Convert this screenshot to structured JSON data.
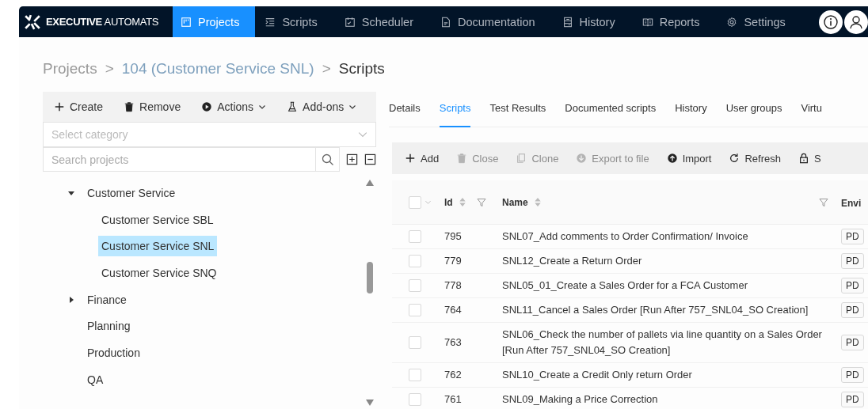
{
  "nav": {
    "logo_bold": "EXECUTIVE",
    "logo_light": "AUTOMATS",
    "items": [
      {
        "label": "Projects",
        "selected": true
      },
      {
        "label": "Scripts",
        "selected": false
      },
      {
        "label": "Scheduler",
        "selected": false
      },
      {
        "label": "Documentation",
        "selected": false
      },
      {
        "label": "History",
        "selected": false
      },
      {
        "label": "Reports",
        "selected": false
      },
      {
        "label": "Settings",
        "selected": false
      }
    ]
  },
  "breadcrumb": [
    {
      "label": "Projects",
      "kind": "link"
    },
    {
      "label": ">",
      "kind": "sep"
    },
    {
      "label": "104 (Customer Service SNL)",
      "kind": "link2"
    },
    {
      "label": ">",
      "kind": "sep"
    },
    {
      "label": "Scripts",
      "kind": "current"
    }
  ],
  "left_toolbar": [
    {
      "label": "Create",
      "dropdown": false
    },
    {
      "label": "Remove",
      "dropdown": false
    },
    {
      "label": "Actions",
      "dropdown": true
    },
    {
      "label": "Add-ons",
      "dropdown": true
    }
  ],
  "category_select": {
    "placeholder": "Select category"
  },
  "project_search": {
    "placeholder": "Search projects"
  },
  "tree": [
    {
      "label": "Customer Service",
      "expanded": true,
      "selected": false,
      "children": [
        {
          "label": "Customer Service SBL",
          "selected": false
        },
        {
          "label": "Customer Service SNL",
          "selected": true
        },
        {
          "label": "Customer Service SNQ",
          "selected": false
        }
      ]
    },
    {
      "label": "Finance",
      "expanded": false,
      "selected": false
    },
    {
      "label": "Planning",
      "selected": false
    },
    {
      "label": "Production",
      "selected": false
    },
    {
      "label": "QA",
      "selected": false
    }
  ],
  "tabs": [
    {
      "label": "Details",
      "selected": false
    },
    {
      "label": "Scripts",
      "selected": true
    },
    {
      "label": "Test Results",
      "selected": false
    },
    {
      "label": "Documented scripts",
      "selected": false
    },
    {
      "label": "History",
      "selected": false
    },
    {
      "label": "User groups",
      "selected": false
    },
    {
      "label": "Virtu",
      "selected": false
    }
  ],
  "toolbar": [
    {
      "label": "Add",
      "disabled": false
    },
    {
      "label": "Close",
      "disabled": true
    },
    {
      "label": "Clone",
      "disabled": true
    },
    {
      "label": "Export to file",
      "disabled": true
    },
    {
      "label": "Import",
      "disabled": false
    },
    {
      "label": "Refresh",
      "disabled": false
    },
    {
      "label": "S",
      "disabled": false
    }
  ],
  "table": {
    "select_all": {
      "checked": false
    },
    "columns": [
      {
        "label": "Id",
        "sortable": true,
        "filter": true
      },
      {
        "label": "Name",
        "sortable": true,
        "filter": true
      },
      {
        "label": "Envi",
        "sortable": false,
        "filter": false
      }
    ],
    "rows": [
      {
        "id": "795",
        "name": "SNL07_Add comments to Order Confirmation/ Invoice",
        "column_3": "PD",
        "checked": false
      },
      {
        "id": "779",
        "name": "SNL12_Create a Return Order",
        "column_3": "PD",
        "checked": false
      },
      {
        "id": "778",
        "name": "SNL05_01_Create a Sales Order for a FCA Customer",
        "column_3": "PD",
        "checked": false
      },
      {
        "id": "764",
        "name": "SNL11_Cancel a Sales Order [Run After 757_SNL04_SO Creation]",
        "column_3": "PD",
        "checked": false
      },
      {
        "id": "763",
        "name": "SNL06_Check the number of pallets via line quantity on a Sales Order [Run After 757_SNL04_SO Creation]",
        "column_3": "PD",
        "checked": false
      },
      {
        "id": "762",
        "name": "SNL10_Create a Credit Only return Order",
        "column_3": "PD",
        "checked": false
      },
      {
        "id": "761",
        "name": "SNL09_Making a Price Correction",
        "column_3": "PD",
        "checked": false
      }
    ]
  }
}
